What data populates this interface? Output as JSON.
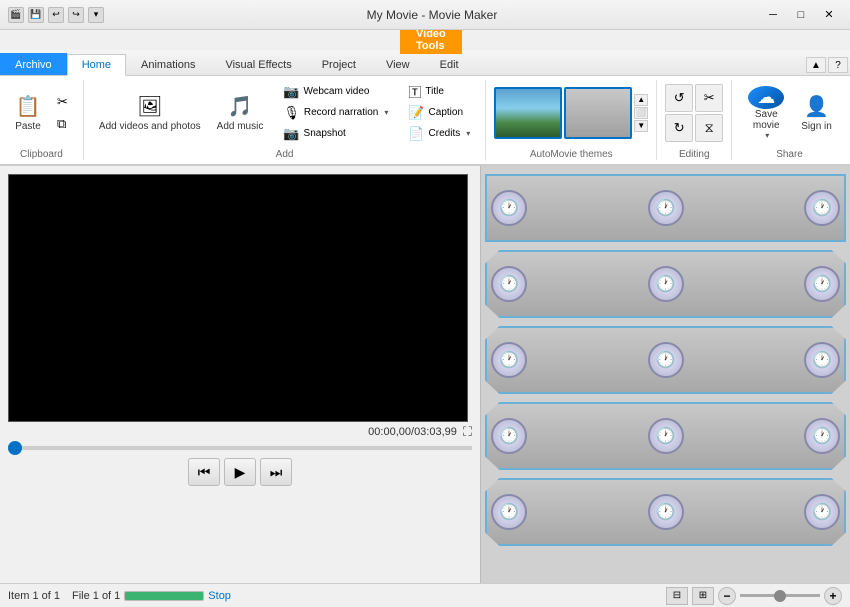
{
  "titlebar": {
    "title": "My Movie - Movie Maker",
    "minimize_label": "─",
    "maximize_label": "□",
    "close_label": "✕"
  },
  "videotoolsbar": {
    "tab_label": "Video Tools"
  },
  "ribbontabs": {
    "archivo": "Archivo",
    "home": "Home",
    "animations": "Animations",
    "visual_effects": "Visual Effects",
    "project": "Project",
    "view": "View",
    "edit": "Edit"
  },
  "ribbon": {
    "clipboard": {
      "label": "Clipboard",
      "paste": "Paste"
    },
    "add": {
      "label": "Add",
      "add_videos": "Add videos\nand photos",
      "add_music": "Add\nmusic",
      "webcam_video": "Webcam video",
      "record_narration": "Record narration",
      "snapshot": "Snapshot",
      "title": "Title",
      "caption": "Caption",
      "credits": "Credits"
    },
    "automovie": {
      "label": "AutoMovie themes"
    },
    "editing": {
      "label": "Editing"
    },
    "share": {
      "label": "Share",
      "save_movie": "Save\nmovie",
      "sign_in": "Sign\nin"
    }
  },
  "video": {
    "time_current": "00:00,00",
    "time_total": "03:03,99"
  },
  "controls": {
    "prev": "⏮",
    "play": "▶",
    "next": "⏭"
  },
  "statusbar": {
    "item": "Item 1 of 1",
    "file": "File 1 of 1",
    "stop": "Stop"
  },
  "filmstrips": [
    {
      "id": 1,
      "clocks": 3
    },
    {
      "id": 2,
      "clocks": 3
    },
    {
      "id": 3,
      "clocks": 3
    },
    {
      "id": 4,
      "clocks": 3
    },
    {
      "id": 5,
      "clocks": 3
    }
  ]
}
